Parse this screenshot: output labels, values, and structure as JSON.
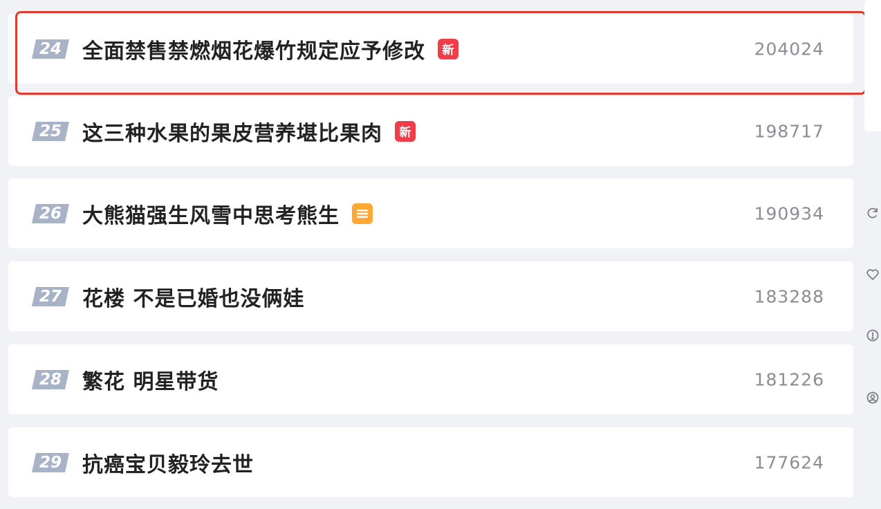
{
  "hot_list": {
    "items": [
      {
        "rank": "24",
        "title": "全面禁售禁燃烟花爆竹规定应予修改",
        "badge": "新",
        "badge_type": "new",
        "count": "204024"
      },
      {
        "rank": "25",
        "title": "这三种水果的果皮营养堪比果肉",
        "badge": "新",
        "badge_type": "new",
        "count": "198717"
      },
      {
        "rank": "26",
        "title": "大熊猫强生风雪中思考熊生",
        "badge": "",
        "badge_type": "hot",
        "count": "190934"
      },
      {
        "rank": "27",
        "title": "花楼 不是已婚也没俩娃",
        "badge": "",
        "badge_type": "none",
        "count": "183288"
      },
      {
        "rank": "28",
        "title": "繁花 明星带货",
        "badge": "",
        "badge_type": "none",
        "count": "181226"
      },
      {
        "rank": "29",
        "title": "抗癌宝贝毅玲去世",
        "badge": "",
        "badge_type": "none",
        "count": "177624"
      }
    ]
  },
  "colors": {
    "rank_badge": "#a8b3c8",
    "new_badge": "#ef3e4a",
    "hot_badge": "#ffa835",
    "highlight": "#e23a2e",
    "side_icon": "#7a7f88"
  },
  "side_icons": [
    "refresh-icon",
    "heart-icon",
    "info-icon",
    "user-icon"
  ]
}
